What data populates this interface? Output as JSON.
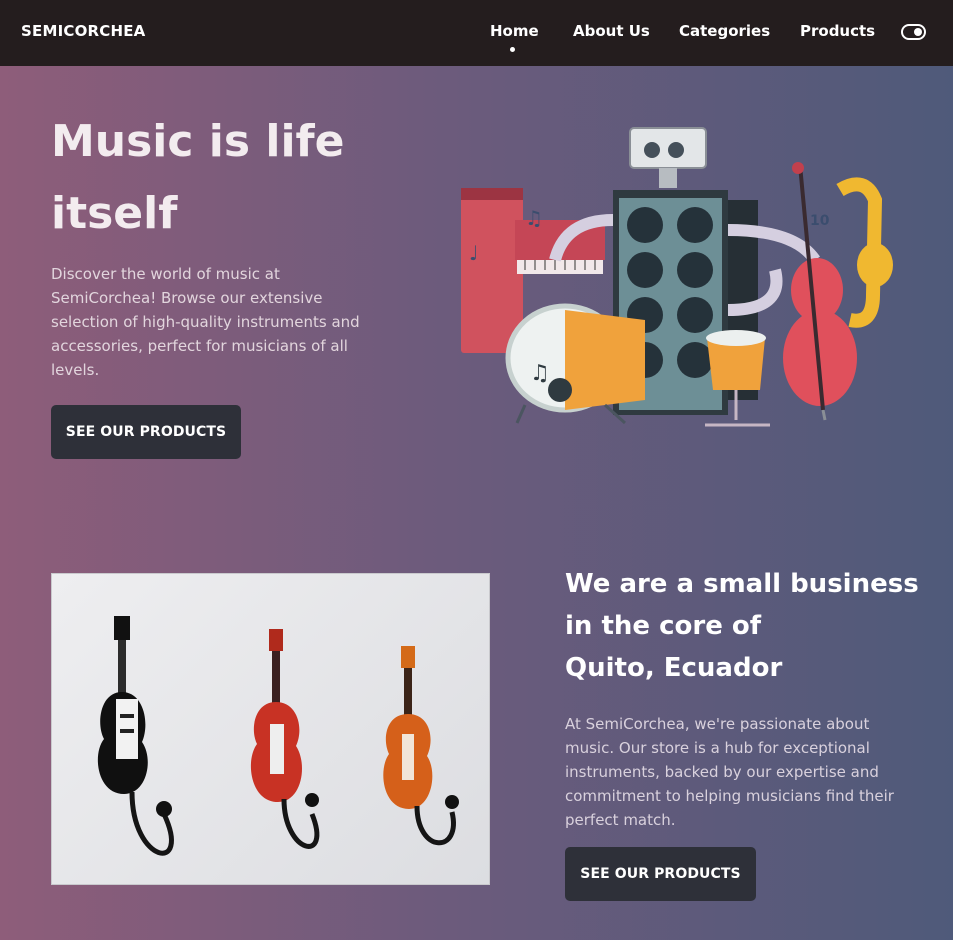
{
  "navbar": {
    "brand": "SEMICORCHEA",
    "links": [
      {
        "label": "Home",
        "active": true
      },
      {
        "label": "About Us",
        "active": false
      },
      {
        "label": "Categories",
        "active": false
      },
      {
        "label": "Products",
        "active": false
      }
    ],
    "theme_toggle_icon": "toggle-icon"
  },
  "hero": {
    "title": "Music is life itself",
    "text": "Discover the world of music at SemiCorchea! Browse our extensive selection of high-quality instruments and accessories, perfect for musicians of all levels.",
    "button_label": "SEE OUR PRODUCTS",
    "illustration_icon": "robot-band-illustration"
  },
  "about": {
    "title_lines": [
      "We are a small business",
      "in the core of",
      "Quito, Ecuador"
    ],
    "text": "At SemiCorchea, we're passionate about music. Our store is a hub for exceptional instruments, backed by our expertise and commitment to helping musicians find their perfect match.",
    "button_label": "SEE OUR PRODUCTS",
    "photo_icon": "guitar-hooks-photo"
  },
  "colors": {
    "navbar_bg": "#241d1e",
    "gradient_left": "#8e5d7a",
    "gradient_right": "#4f5a7a",
    "button_bg": "#2e3039"
  }
}
